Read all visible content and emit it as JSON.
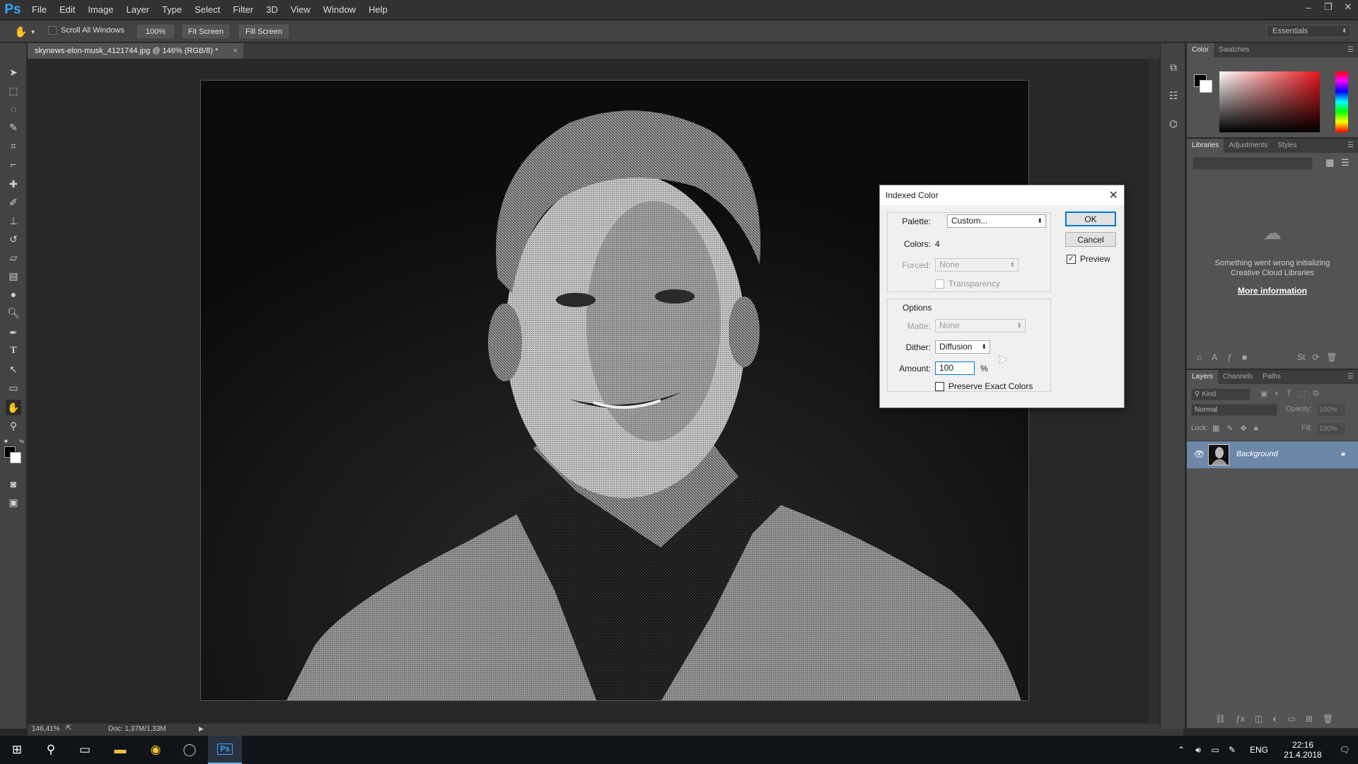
{
  "app": {
    "logo": "Ps"
  },
  "menu": [
    "File",
    "Edit",
    "Image",
    "Layer",
    "Type",
    "Select",
    "Filter",
    "3D",
    "View",
    "Window",
    "Help"
  ],
  "window_controls": {
    "minimize": "‒",
    "restore": "❐",
    "close": "✕"
  },
  "options_bar": {
    "scroll_all_label": "Scroll All Windows",
    "zoom_btn": "100%",
    "fit_screen": "Fit Screen",
    "fill_screen": "Fill Screen",
    "workspace": "Essentials"
  },
  "tools": [
    "move-tool-icon",
    "marquee-tool-icon",
    "lasso-tool-icon",
    "quick-select-tool-icon",
    "crop-tool-icon",
    "eyedropper-tool-icon",
    "healing-brush-tool-icon",
    "brush-tool-icon",
    "clone-stamp-tool-icon",
    "history-brush-tool-icon",
    "eraser-tool-icon",
    "gradient-tool-icon",
    "blur-tool-icon",
    "dodge-tool-icon",
    "pen-tool-icon",
    "type-tool-icon",
    "path-selection-tool-icon",
    "rectangle-tool-icon",
    "hand-tool-icon",
    "zoom-tool-icon"
  ],
  "document": {
    "tab_title": "skynews-elon-musk_4121744.jpg @ 146% (RGB/8) *",
    "zoom_status": "146,41%",
    "doc_status": "Doc: 1,37M/1,33M"
  },
  "color_panel": {
    "tabs": [
      "Color",
      "Swatches"
    ]
  },
  "libraries_panel": {
    "tabs": [
      "Libraries",
      "Adjustments",
      "Styles"
    ],
    "error_line1": "Something went wrong initializing",
    "error_line2": "Creative Cloud Libraries",
    "more_info": "More information"
  },
  "layers_panel": {
    "tabs": [
      "Layers",
      "Channels",
      "Paths"
    ],
    "filter_kind": "Kind",
    "blend_mode": "Normal",
    "opacity_label": "Opacity:",
    "opacity_value": "100%",
    "lock_label": "Lock:",
    "fill_label": "Fill:",
    "fill_value": "100%",
    "layers": [
      {
        "name": "Background"
      }
    ]
  },
  "dialog": {
    "title": "Indexed Color",
    "palette_label": "Palette:",
    "palette_value": "Custom...",
    "colors_label": "Colors:",
    "colors_value": "4",
    "forced_label": "Forced:",
    "forced_value": "None",
    "transparency_label": "Transparency",
    "options_title": "Options",
    "matte_label": "Matte:",
    "matte_value": "None",
    "dither_label": "Dither:",
    "dither_value": "Diffusion",
    "amount_label": "Amount:",
    "amount_value": "100",
    "amount_unit": "%",
    "preserve_label": "Preserve Exact Colors",
    "ok": "OK",
    "cancel": "Cancel",
    "preview_label": "Preview",
    "preview_checked": true
  },
  "taskbar": {
    "language": "ENG",
    "time": "22:16",
    "date": "21.4.2018"
  }
}
